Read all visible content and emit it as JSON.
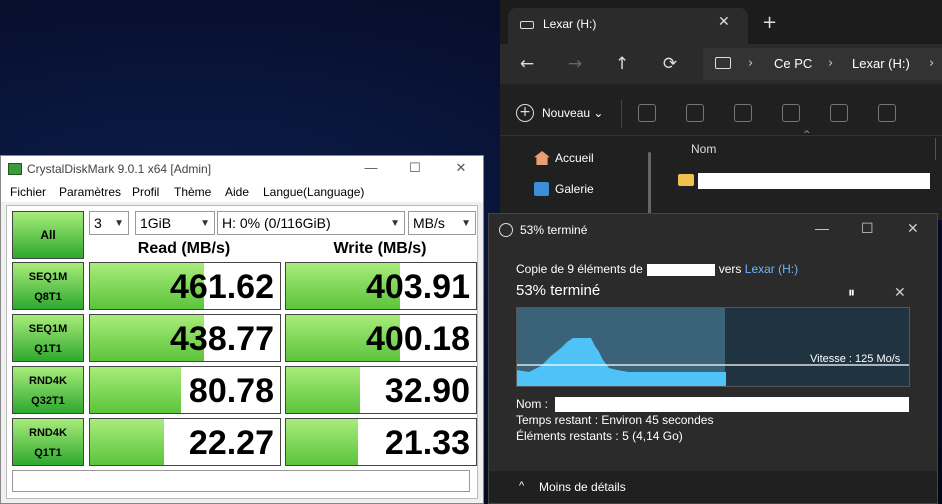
{
  "explorer": {
    "tab_title": "Lexar (H:)",
    "tab_close": "✕",
    "new_tab": "+",
    "back": "←",
    "forward": "→",
    "up": "↑",
    "refresh": "⟳",
    "breadcrumbs": [
      "Ce PC",
      "Lexar (H:)"
    ],
    "chevron": "›",
    "new_button": "Nouveau ⌄",
    "nav_items": [
      "Accueil",
      "Galerie"
    ],
    "column_name": "Nom",
    "sort_caret": "^",
    "icons": [
      "drive-icon",
      "pc-icon",
      "cut-icon",
      "copy-icon",
      "paste-icon",
      "rename-icon",
      "share-icon",
      "delete-icon",
      "home-icon",
      "gallery-icon",
      "folder-icon"
    ]
  },
  "cdm": {
    "title": "CrystalDiskMark 9.0.1 x64 [Admin]",
    "window_buttons": [
      "—",
      "☐",
      "✕"
    ],
    "menu": [
      "Fichier",
      "Paramètres",
      "Profil",
      "Thème",
      "Aide",
      "Langue(Language)"
    ],
    "all_button": "All",
    "count_select": "3",
    "size_select": "1GiB",
    "drive_select": "H: 0% (0/116GiB)",
    "unit_select": "MB/s",
    "read_header": "Read (MB/s)",
    "write_header": "Write (MB/s)",
    "tests": [
      {
        "line1": "SEQ1M",
        "line2": "Q8T1",
        "read": "461.62",
        "write": "403.91",
        "read_fill": 0.6,
        "write_fill": 0.6
      },
      {
        "line1": "SEQ1M",
        "line2": "Q1T1",
        "read": "438.77",
        "write": "400.18",
        "read_fill": 0.6,
        "write_fill": 0.6
      },
      {
        "line1": "RND4K",
        "line2": "Q32T1",
        "read": "80.78",
        "write": "32.90",
        "read_fill": 0.48,
        "write_fill": 0.39
      },
      {
        "line1": "RND4K",
        "line2": "Q1T1",
        "read": "22.27",
        "write": "21.33",
        "read_fill": 0.39,
        "write_fill": 0.38
      }
    ],
    "accent_green": "#3cb43c"
  },
  "copy_dialog": {
    "title": "53% terminé",
    "window_buttons": [
      "—",
      "☐",
      "✕"
    ],
    "desc_prefix": "Copie de 9 éléments de",
    "desc_mid": "vers",
    "desc_target": "Lexar (H:)",
    "percent_label": "53% terminé",
    "pause": "⏸",
    "cancel": "✕",
    "progress": 0.53,
    "speed": "Vitesse : 125 Mo/s",
    "name_label": "Nom :",
    "time_label": "Temps restant :",
    "time_value": "Environ 45 secondes",
    "items_label": "Éléments restants :",
    "items_value": "5 (4,14 Go)",
    "less_details": "Moins de détails",
    "less_chevron": "^"
  }
}
